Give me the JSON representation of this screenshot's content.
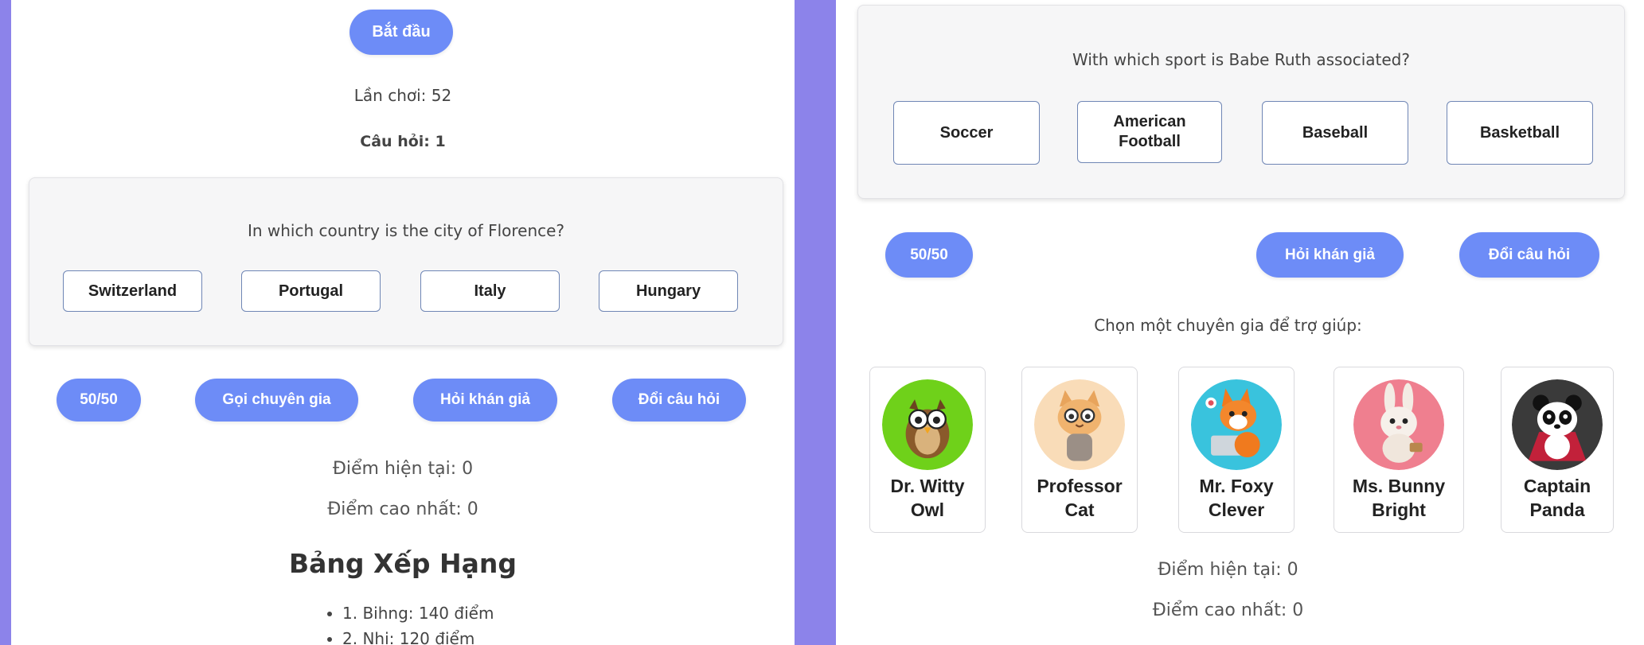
{
  "left": {
    "start_button": "Bắt đầu",
    "plays": "Lần chơi: 52",
    "question_number": "Câu hỏi: 1",
    "question": "In which country is the city of Florence?",
    "answers": [
      "Switzerland",
      "Portugal",
      "Italy",
      "Hungary"
    ],
    "lifelines": {
      "fifty": "50/50",
      "call_expert": "Gọi chuyên gia",
      "ask_audience": "Hỏi khán giả",
      "change_question": "Đổi câu hỏi"
    },
    "current_score": "Điểm hiện tại: 0",
    "high_score": "Điểm cao nhất: 0",
    "leaderboard_title": "Bảng Xếp Hạng",
    "leaderboard": [
      "1. Bihng: 140 điểm",
      "2. Nhi: 120 điểm"
    ]
  },
  "right": {
    "question": "With which sport is Babe Ruth associated?",
    "answers": [
      "Soccer",
      "American Football",
      "Baseball",
      "Basketball"
    ],
    "lifelines": {
      "fifty": "50/50",
      "ask_audience": "Hỏi khán giả",
      "change_question": "Đổi câu hỏi"
    },
    "expert_prompt": "Chọn một chuyên gia để trợ giúp:",
    "experts": [
      {
        "name": "Dr. Witty Owl",
        "icon": "owl-icon",
        "bg": "#6fd11a"
      },
      {
        "name": "Professor Cat",
        "icon": "cat-icon",
        "bg": "#f9dcb8"
      },
      {
        "name": "Mr. Foxy Clever",
        "icon": "fox-icon",
        "bg": "#39c3dd"
      },
      {
        "name": "Ms. Bunny Bright",
        "icon": "bunny-icon",
        "bg": "#ef7f8f"
      },
      {
        "name": "Captain Panda",
        "icon": "panda-icon",
        "bg": "#3a3a3a"
      }
    ],
    "current_score": "Điểm hiện tại: 0",
    "high_score": "Điểm cao nhất: 0"
  },
  "colors": {
    "background": "#8c83ea",
    "button": "#6d8cf7",
    "answer_border": "#6f86b5"
  }
}
